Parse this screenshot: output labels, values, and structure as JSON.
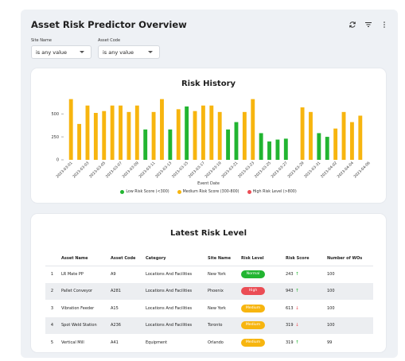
{
  "header": {
    "title": "Asset Risk Predictor Overview"
  },
  "filters": {
    "site_label": "Site Name",
    "site_value": "is any value",
    "asset_label": "Asset Code",
    "asset_value": "is any value"
  },
  "colors": {
    "low": "#22b531",
    "medium": "#f7b50f",
    "high": "#eb4d55",
    "accent_bg": "#eef1f5"
  },
  "chart_data": {
    "type": "bar",
    "title": "Risk History",
    "xlabel": "Event Date",
    "ylabel": "",
    "ylim": [
      0,
      700
    ],
    "yticks": [
      0,
      250,
      500
    ],
    "grid": false,
    "legend_placement": "bottom",
    "legend": [
      {
        "label": "Low Risk Score (<300)",
        "color": "#22b531"
      },
      {
        "label": "Medium Risk Score (300-800)",
        "color": "#f7b50f"
      },
      {
        "label": "High Risk Level (>800)",
        "color": "#eb4d55"
      }
    ],
    "tick_labels": [
      "2023-03-01",
      "2023-03-03",
      "2023-03-05",
      "2023-03-07",
      "2023-03-09",
      "2023-03-11",
      "2023-03-13",
      "2023-03-15",
      "2023-03-17",
      "2023-03-19",
      "2023-03-21",
      "2023-03-23",
      "2023-03-25",
      "2023-03-27",
      "2023-03-29",
      "2023-03-31",
      "2023-04-02",
      "2023-04-04",
      "2023-04-06"
    ],
    "values": [
      660,
      390,
      590,
      510,
      530,
      590,
      590,
      520,
      590,
      330,
      520,
      660,
      330,
      550,
      580,
      530,
      590,
      590,
      520,
      330,
      410,
      520,
      660,
      290,
      200,
      220,
      230,
      0,
      570,
      520,
      290,
      250,
      340,
      520,
      410,
      480
    ],
    "levels": [
      "m",
      "m",
      "m",
      "m",
      "m",
      "m",
      "m",
      "m",
      "m",
      "l",
      "m",
      "m",
      "l",
      "m",
      "l",
      "m",
      "m",
      "m",
      "m",
      "l",
      "l",
      "m",
      "m",
      "l",
      "l",
      "l",
      "l",
      "m",
      "m",
      "m",
      "l",
      "l",
      "m",
      "m",
      "m",
      "m"
    ]
  },
  "table": {
    "title": "Latest Risk Level",
    "columns": [
      "",
      "Asset Name",
      "Asset Code",
      "Category",
      "Site Name",
      "Risk Level",
      "Risk Score",
      "Number of WOs"
    ],
    "rows": [
      {
        "idx": "1",
        "name": "LR Mate PP",
        "code": "A9",
        "category": "Locations And Facilities",
        "site": "New York",
        "level": "Normal",
        "level_color": "#22b531",
        "score": "243",
        "trend": "up",
        "wos": "100"
      },
      {
        "idx": "2",
        "name": "Pallet Conveyor",
        "code": "A281",
        "category": "Locations And Facilities",
        "site": "Phoenix",
        "level": "High",
        "level_color": "#eb4d55",
        "score": "943",
        "trend": "up",
        "wos": "100"
      },
      {
        "idx": "3",
        "name": "Vibration Feeder",
        "code": "A15",
        "category": "Locations And Facilities",
        "site": "New York",
        "level": "Medium",
        "level_color": "#f7b50f",
        "score": "613",
        "trend": "down",
        "wos": "100"
      },
      {
        "idx": "4",
        "name": "Spot Weld Station",
        "code": "A236",
        "category": "Locations And Facilities",
        "site": "Toronto",
        "level": "Medium",
        "level_color": "#f7b50f",
        "score": "319",
        "trend": "down",
        "wos": "100"
      },
      {
        "idx": "5",
        "name": "Vertical Mill",
        "code": "A41",
        "category": "Equipment",
        "site": "Orlando",
        "level": "Medium",
        "level_color": "#f7b50f",
        "score": "319",
        "trend": "up",
        "wos": "99"
      }
    ]
  }
}
